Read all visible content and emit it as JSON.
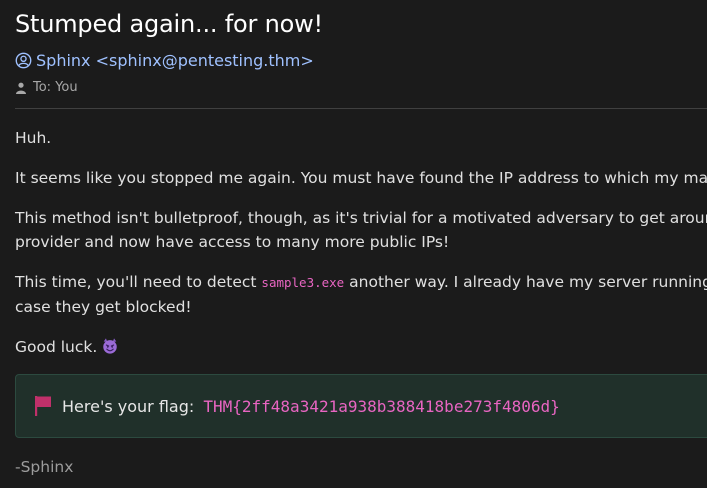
{
  "email": {
    "subject": "Stumped again... for now!",
    "sender": "Sphinx <sphinx@pentesting.thm>",
    "to": "To: You",
    "body": {
      "p1": "Huh.",
      "p2": "It seems like you stopped me again. You must have found the IP address to which my malwar",
      "p3_line1": "This method isn't bulletproof, though, as it's trivial for a motivated adversary to get around it",
      "p3_line2": "provider and now have access to many more public IPs!",
      "p4_pre": "This time, you'll need to detect ",
      "p4_code": "sample3.exe",
      "p4_post": " another way. I already have my server running fro",
      "p4_line2": "case they get blocked!",
      "p5": "Good luck."
    },
    "flag": {
      "label": "Here's your flag:",
      "value": "THM{2ff48a3421a938b388418be273f4806d}",
      "icon": "flag-icon",
      "accent": "#e865c2"
    },
    "signature": "-Sphinx"
  },
  "colors": {
    "background": "#1b1b1b",
    "sender": "#9fc1ff",
    "flag_box": "#20302a",
    "flag_icon": "#c0306a"
  }
}
